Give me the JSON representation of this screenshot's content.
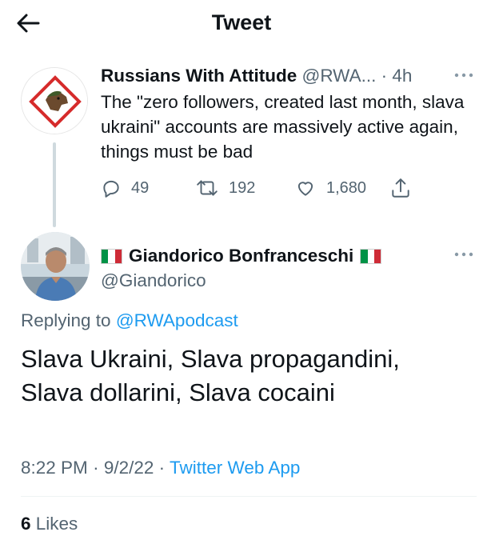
{
  "header": {
    "title": "Tweet",
    "back_icon": "arrow-left-icon"
  },
  "parent_tweet": {
    "author_name": "Russians With Attitude",
    "author_handle": "@RWA...",
    "dot": "·",
    "time": "4h",
    "text": "The \"zero followers, created last month, slava ukraini\" accounts are massively active again, things must be bad",
    "replies": "49",
    "retweets": "192",
    "likes": "1,680"
  },
  "main_tweet": {
    "author_name": "Giandorico Bonfranceschi",
    "author_handle": "@Giandorico",
    "replying_prefix": "Replying to",
    "replying_to": "@RWApodcast",
    "text_line1": "Slava Ukraini, Slava propagandini,",
    "text_line2": "Slava dollarini, Slava cocaini",
    "time": "8:22 PM",
    "date": "9/2/22",
    "source": "Twitter Web App",
    "meta_dot": "·",
    "likes_count": "6",
    "likes_label": "Likes"
  },
  "colors": {
    "accent": "#1d9bf0",
    "secondary_text": "#536471",
    "flag_green": "#009246",
    "flag_white": "#ffffff",
    "flag_red": "#ce2b37"
  }
}
